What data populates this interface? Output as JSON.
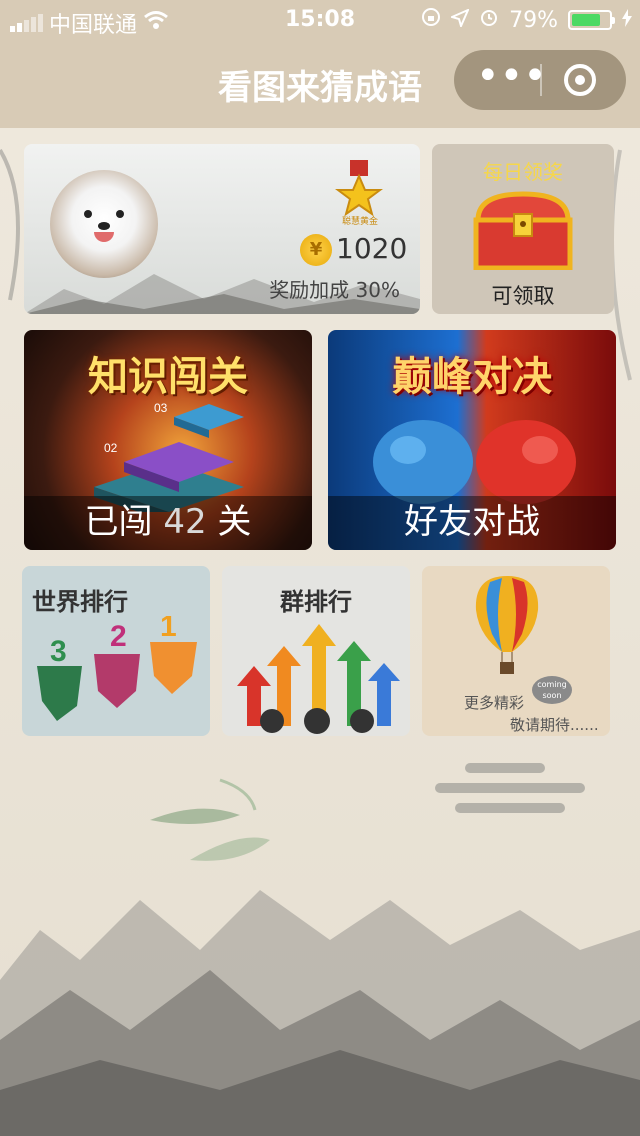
{
  "status_bar": {
    "carrier": "中国联通",
    "time": "15:08",
    "battery_percent": "79%",
    "battery_level": 0.79
  },
  "nav": {
    "title": "看图来猜成语",
    "more_icon": "more-dots-icon",
    "close_icon": "close-target-icon"
  },
  "profile": {
    "medal_text": "聪慧黄金",
    "coin_symbol": "¥",
    "coins": "1020",
    "bonus": "奖励加成 30%"
  },
  "daily": {
    "title": "每日领奖",
    "status": "可领取"
  },
  "stage": {
    "title": "知识闯关",
    "progress_prefix": "已闯 ",
    "progress_num": "42",
    "progress_suffix": " 关"
  },
  "battle": {
    "title": "巅峰对决",
    "label": "好友对战"
  },
  "rankings": {
    "world": "世界排行",
    "group": "群排行",
    "more_line1": "更多精彩",
    "more_line2": "敬请期待......",
    "coming": "coming soon"
  },
  "colors": {
    "bar_bg": "#d8cbb6",
    "battery_green": "#4cd964",
    "gold": "#f6d74a"
  }
}
